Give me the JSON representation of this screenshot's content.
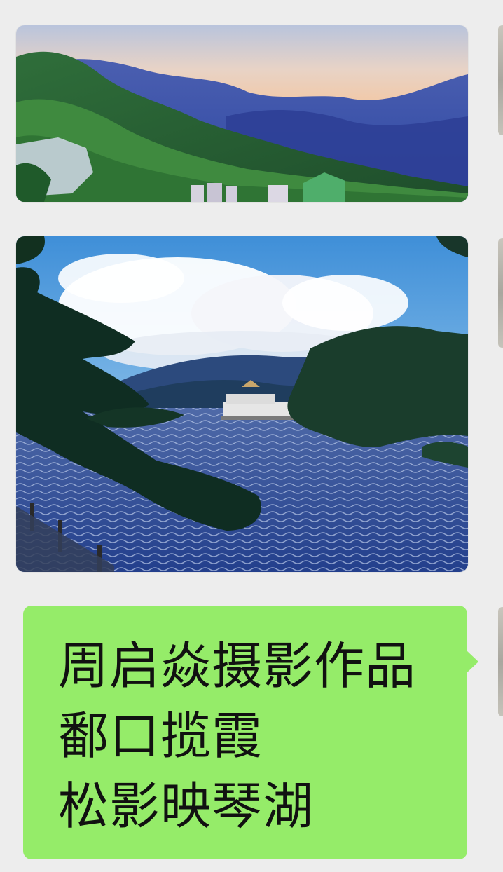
{
  "chat": {
    "messages": [
      {
        "type": "image",
        "subject": "mountain-sunset-photo"
      },
      {
        "type": "image",
        "subject": "pine-lake-photo"
      },
      {
        "type": "text",
        "lines": [
          "周启焱摄影作品",
          "鄱口揽霞",
          "松影映琴湖"
        ]
      }
    ]
  },
  "colors": {
    "background": "#ededed",
    "bubble": "#95ec69",
    "text": "#111111"
  }
}
